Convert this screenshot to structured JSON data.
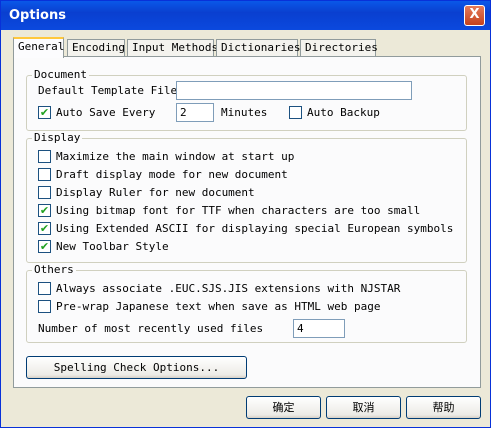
{
  "window": {
    "title": "Options",
    "close_glyph": "X"
  },
  "tabs": [
    {
      "label": "General"
    },
    {
      "label": "Encoding"
    },
    {
      "label": "Input Methods"
    },
    {
      "label": "Dictionaries"
    },
    {
      "label": "Directories"
    }
  ],
  "document": {
    "legend": "Document",
    "template_label": "Default Template File",
    "template_value": "",
    "autosave_label": "Auto Save Every",
    "autosave_checked": true,
    "autosave_value": "2",
    "minutes_label": "Minutes",
    "autobackup_label": "Auto Backup",
    "autobackup_checked": false
  },
  "display": {
    "legend": "Display",
    "options": [
      {
        "label": "Maximize the main window at start up",
        "checked": false
      },
      {
        "label": "Draft display mode for new document",
        "checked": false
      },
      {
        "label": "Display Ruler for new document",
        "checked": false
      },
      {
        "label": "Using bitmap font for TTF when characters are too small",
        "checked": true
      },
      {
        "label": "Using Extended ASCII for displaying special European symbols",
        "checked": true
      },
      {
        "label": "New Toolbar Style",
        "checked": true
      }
    ]
  },
  "others": {
    "legend": "Others",
    "options": [
      {
        "label": "Always associate .EUC.SJS.JIS extensions with NJSTAR",
        "checked": false
      },
      {
        "label": "Pre-wrap Japanese text when save as HTML web page",
        "checked": false
      }
    ],
    "recent_label": "Number of most recently used files",
    "recent_value": "4"
  },
  "spelling_button": "Spelling Check Options...",
  "footer": {
    "ok": "确定",
    "cancel": "取消",
    "help": "帮助"
  },
  "check_glyph": "✔"
}
